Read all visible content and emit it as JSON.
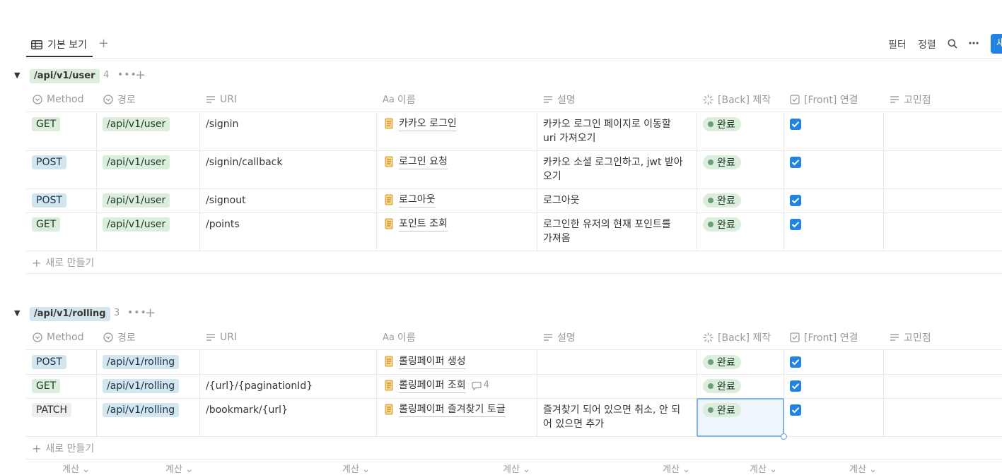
{
  "toolbar": {
    "view_tab": "기본 보기",
    "filter": "필터",
    "sort": "정렬",
    "new_button": "새"
  },
  "columns": {
    "method": "Method",
    "path": "경로",
    "uri": "URI",
    "name": "이름",
    "desc": "설명",
    "back": "[Back] 제작",
    "front": "[Front] 연결",
    "concern": "고민점"
  },
  "groups": [
    {
      "title": "/api/v1/user",
      "count": "4",
      "new_row": "새로 만들기",
      "rows": [
        {
          "method": "GET",
          "path": "/api/v1/user",
          "uri": "/signin",
          "name": "카카오 로그인",
          "desc_l1": "카카오 로그인 페이지로 이동할",
          "desc_l2": "uri 가져오기",
          "status": "완료"
        },
        {
          "method": "POST",
          "path": "/api/v1/user",
          "uri": "/signin/callback",
          "name": "로그인 요청",
          "desc_l1": "카카오 소셜 로그인하고, jwt 받아",
          "desc_l2": "오기",
          "status": "완료"
        },
        {
          "method": "POST",
          "path": "/api/v1/user",
          "uri": "/signout",
          "name": "로그아웃",
          "desc_l1": "로그아웃",
          "desc_l2": "",
          "status": "완료"
        },
        {
          "method": "GET",
          "path": "/api/v1/user",
          "uri": "/points",
          "name": "포인트 조회",
          "desc_l1": "로그인한 유저의 현재 포인트를",
          "desc_l2": "가져옴",
          "status": "완료"
        }
      ]
    },
    {
      "title": "/api/v1/rolling",
      "count": "3",
      "new_row": "새로 만들기",
      "rows": [
        {
          "method": "POST",
          "path": "/api/v1/rolling",
          "uri": "",
          "name": "롤링페이퍼 생성",
          "desc_l1": "",
          "desc_l2": "",
          "status": "완료"
        },
        {
          "method": "GET",
          "path": "/api/v1/rolling",
          "uri": "/{url}/{paginationId}",
          "name": "롤링페이퍼 조회",
          "comments": "4",
          "desc_l1": "",
          "desc_l2": "",
          "status": "완료"
        },
        {
          "method": "PATCH",
          "path": "/api/v1/rolling",
          "uri": "/bookmark/{url}",
          "name": "롤링페이퍼 즐겨찾기 토글",
          "desc_l1": "즐겨찾기 되어 있으면 취소, 안 되",
          "desc_l2": "어 있으면 추가",
          "status": "완료"
        }
      ]
    }
  ],
  "footer": {
    "calc": "계산"
  },
  "colors": {
    "accent": "#2383e2",
    "done_bg": "#dbeddb",
    "done_dot": "#6c9b7d"
  },
  "icons": [
    "table-icon",
    "plus-icon",
    "search-icon",
    "more-icon",
    "select-icon",
    "text-icon",
    "title-icon",
    "status-icon",
    "checkbox-icon",
    "document-icon",
    "comment-icon",
    "chevron-down-icon"
  ]
}
